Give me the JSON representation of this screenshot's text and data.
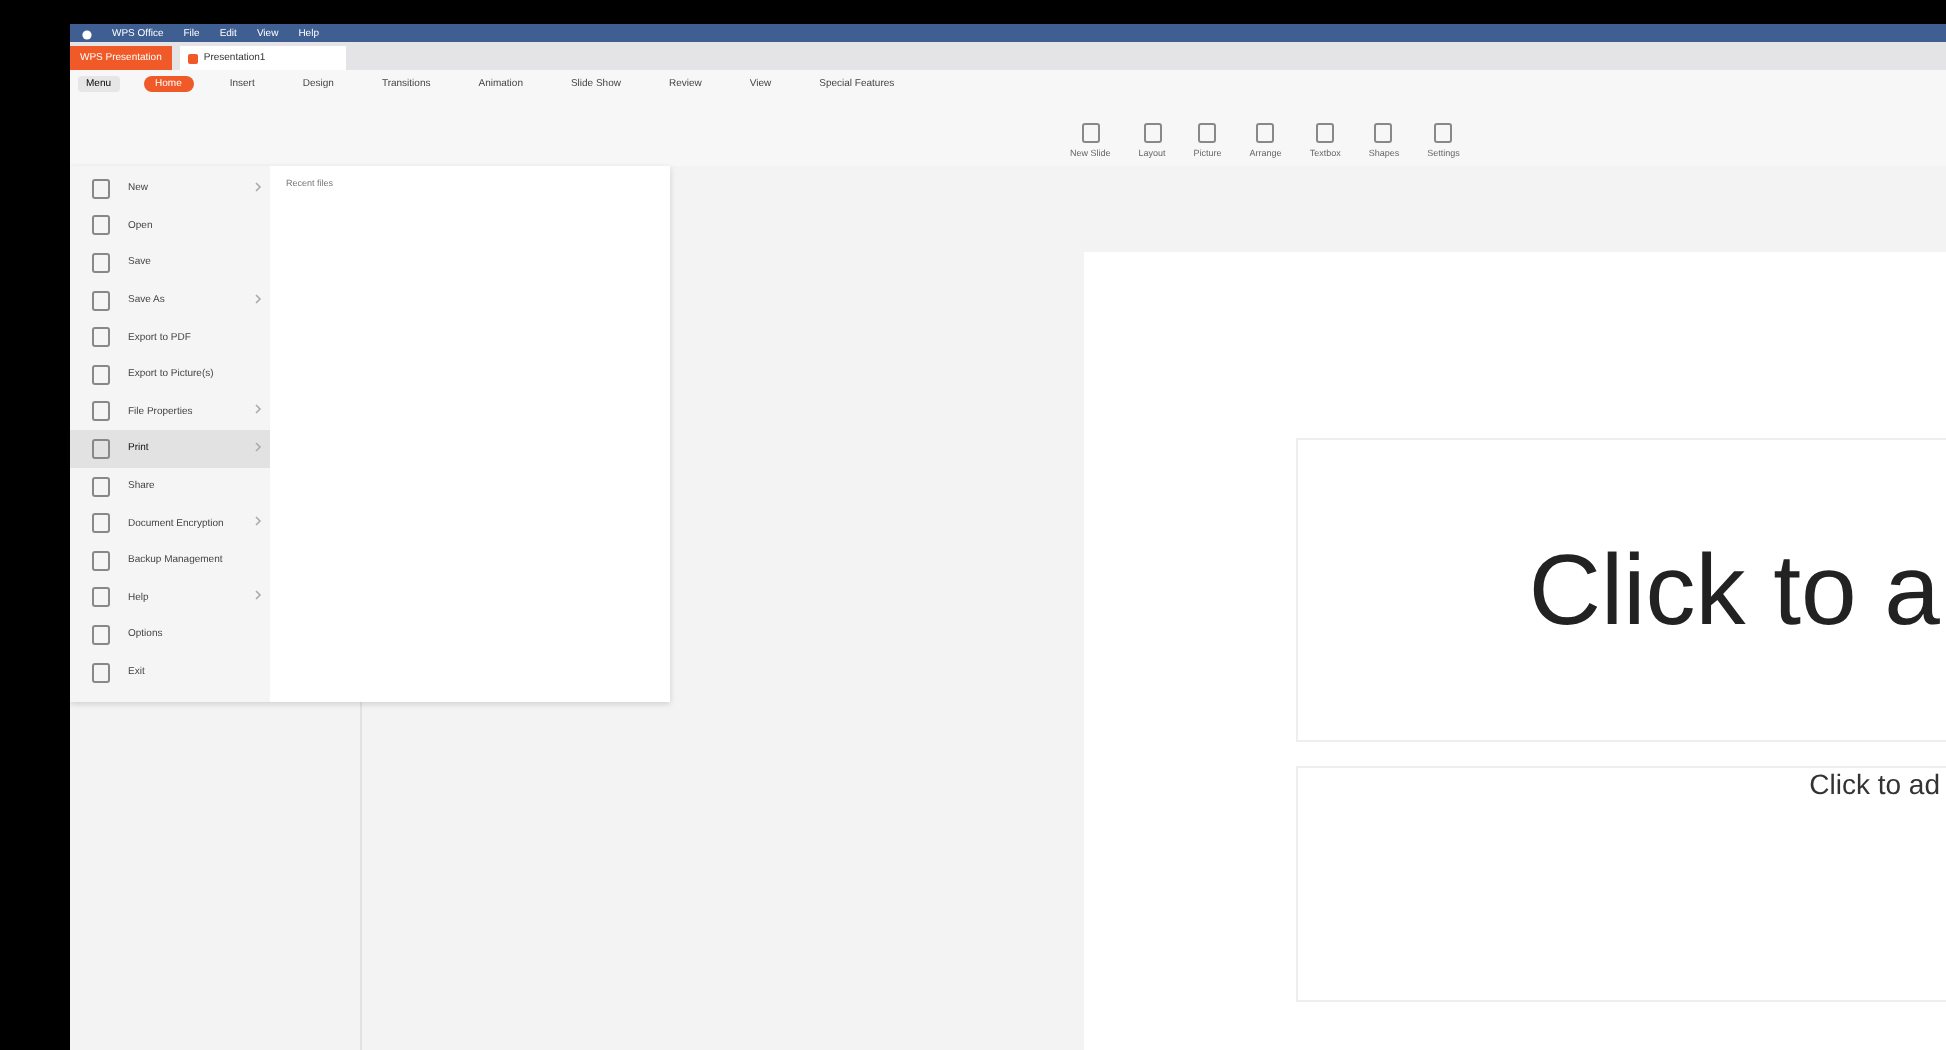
{
  "menu_bar": {
    "items": [
      "WPS Office",
      "File",
      "Edit",
      "View",
      "Help"
    ]
  },
  "app_button": "WPS Presentation",
  "doc_tab": {
    "title": "Presentation1"
  },
  "menu_button": "Menu",
  "ribbon_tabs": [
    {
      "label": "Home",
      "selected": true
    },
    {
      "label": "Insert",
      "selected": false
    },
    {
      "label": "Design",
      "selected": false
    },
    {
      "label": "Transitions",
      "selected": false
    },
    {
      "label": "Animation",
      "selected": false
    },
    {
      "label": "Slide Show",
      "selected": false
    },
    {
      "label": "Review",
      "selected": false
    },
    {
      "label": "View",
      "selected": false
    },
    {
      "label": "Special Features",
      "selected": false
    }
  ],
  "ribbon_buttons": [
    "New Slide",
    "Layout",
    "Picture",
    "Arrange",
    "Textbox",
    "Shapes",
    "Settings"
  ],
  "file_menu": [
    {
      "label": "New",
      "submenu": true,
      "selected": false
    },
    {
      "label": "Open",
      "submenu": false,
      "selected": false
    },
    {
      "label": "Save",
      "submenu": false,
      "selected": false
    },
    {
      "label": "Save As",
      "submenu": true,
      "selected": false
    },
    {
      "label": "Export to PDF",
      "submenu": false,
      "selected": false
    },
    {
      "label": "Export to Picture(s)",
      "submenu": false,
      "selected": false
    },
    {
      "label": "File Properties",
      "submenu": true,
      "selected": false
    },
    {
      "label": "Print",
      "submenu": true,
      "selected": true
    },
    {
      "label": "Share",
      "submenu": false,
      "selected": false
    },
    {
      "label": "Document Encryption",
      "submenu": true,
      "selected": false
    },
    {
      "label": "Backup Management",
      "submenu": false,
      "selected": false
    },
    {
      "label": "Help",
      "submenu": true,
      "selected": false
    },
    {
      "label": "Options",
      "submenu": false,
      "selected": false
    },
    {
      "label": "Exit",
      "submenu": false,
      "selected": false
    }
  ],
  "recent_panel": {
    "title": "Recent files"
  },
  "slide": {
    "title_placeholder": "Click to a",
    "subtitle_placeholder": "Click to ad"
  }
}
